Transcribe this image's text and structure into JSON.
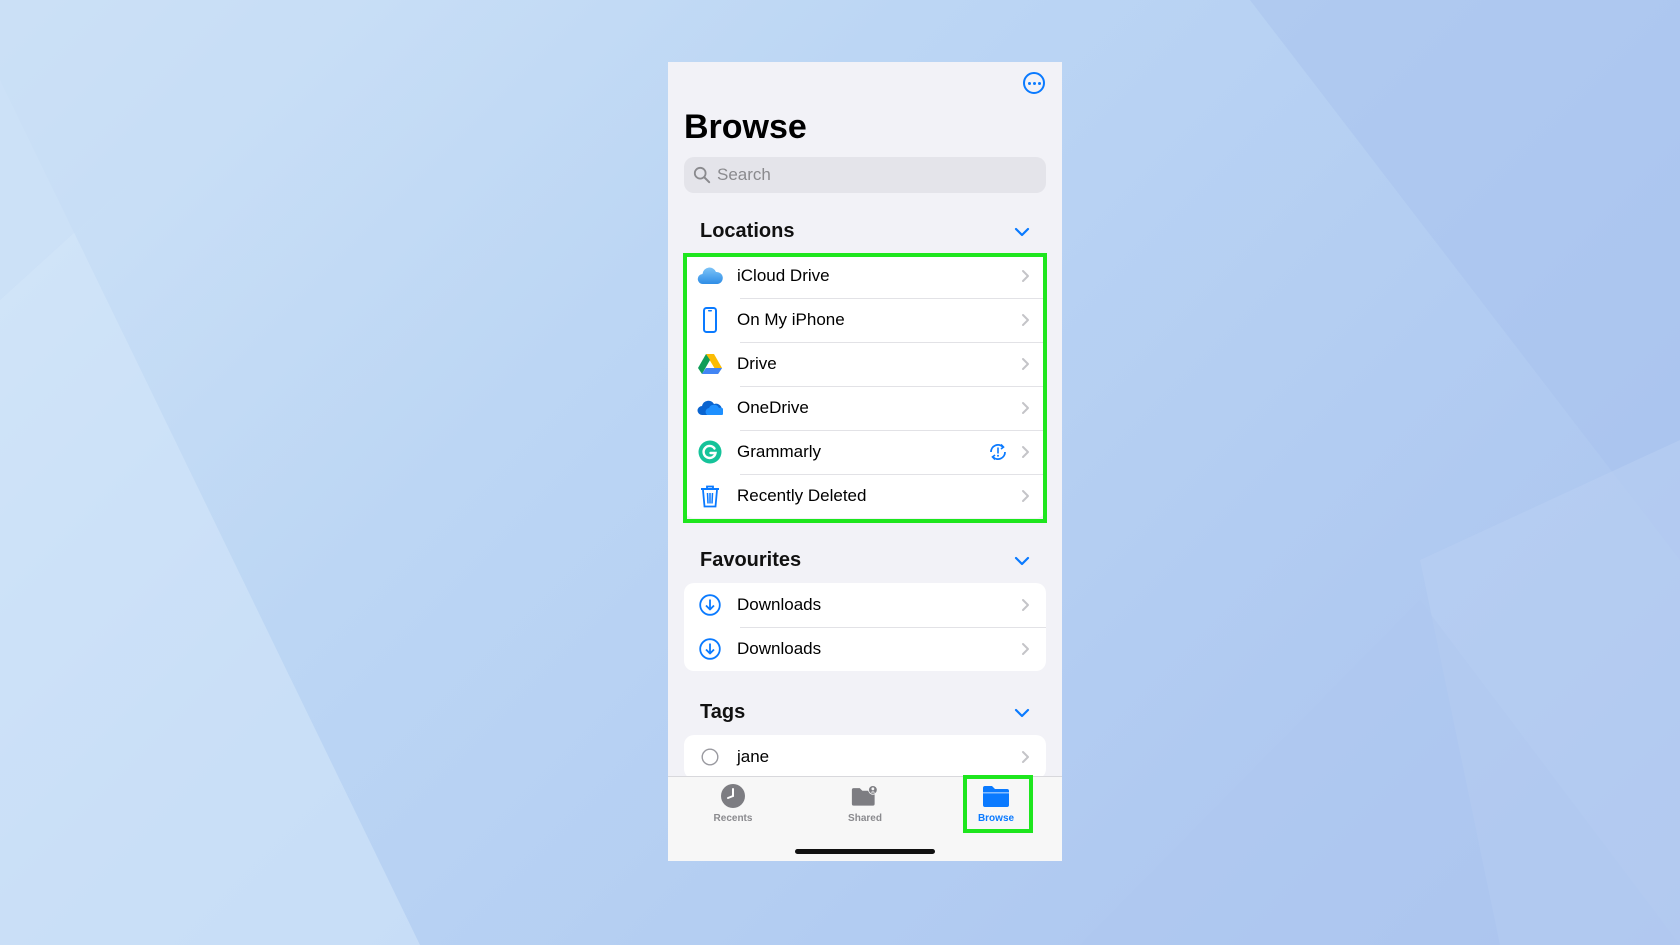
{
  "header": {
    "title": "Browse",
    "more_icon": "ellipsis-circle-icon"
  },
  "search": {
    "placeholder": "Search",
    "icon": "search-icon"
  },
  "sections": {
    "locations": {
      "title": "Locations",
      "items": [
        {
          "label": "iCloud Drive",
          "icon": "icloud-icon"
        },
        {
          "label": "On My iPhone",
          "icon": "iphone-icon"
        },
        {
          "label": "Drive",
          "icon": "google-drive-icon"
        },
        {
          "label": "OneDrive",
          "icon": "onedrive-icon"
        },
        {
          "label": "Grammarly",
          "icon": "grammarly-icon",
          "badge": "sync-alert-icon"
        },
        {
          "label": "Recently Deleted",
          "icon": "trash-icon"
        }
      ]
    },
    "favourites": {
      "title": "Favourites",
      "items": [
        {
          "label": "Downloads",
          "icon": "download-circle-icon"
        },
        {
          "label": "Downloads",
          "icon": "download-circle-icon"
        }
      ]
    },
    "tags": {
      "title": "Tags",
      "items": [
        {
          "label": "jane",
          "icon": "empty-tag-circle-icon"
        }
      ]
    }
  },
  "tabbar": {
    "tabs": [
      {
        "label": "Recents",
        "icon": "clock-icon"
      },
      {
        "label": "Shared",
        "icon": "shared-folder-icon"
      },
      {
        "label": "Browse",
        "icon": "folder-icon",
        "active": true
      }
    ]
  },
  "colors": {
    "accent": "#0a7aff",
    "highlight": "#1ee61e",
    "background": "#f2f2f7"
  }
}
